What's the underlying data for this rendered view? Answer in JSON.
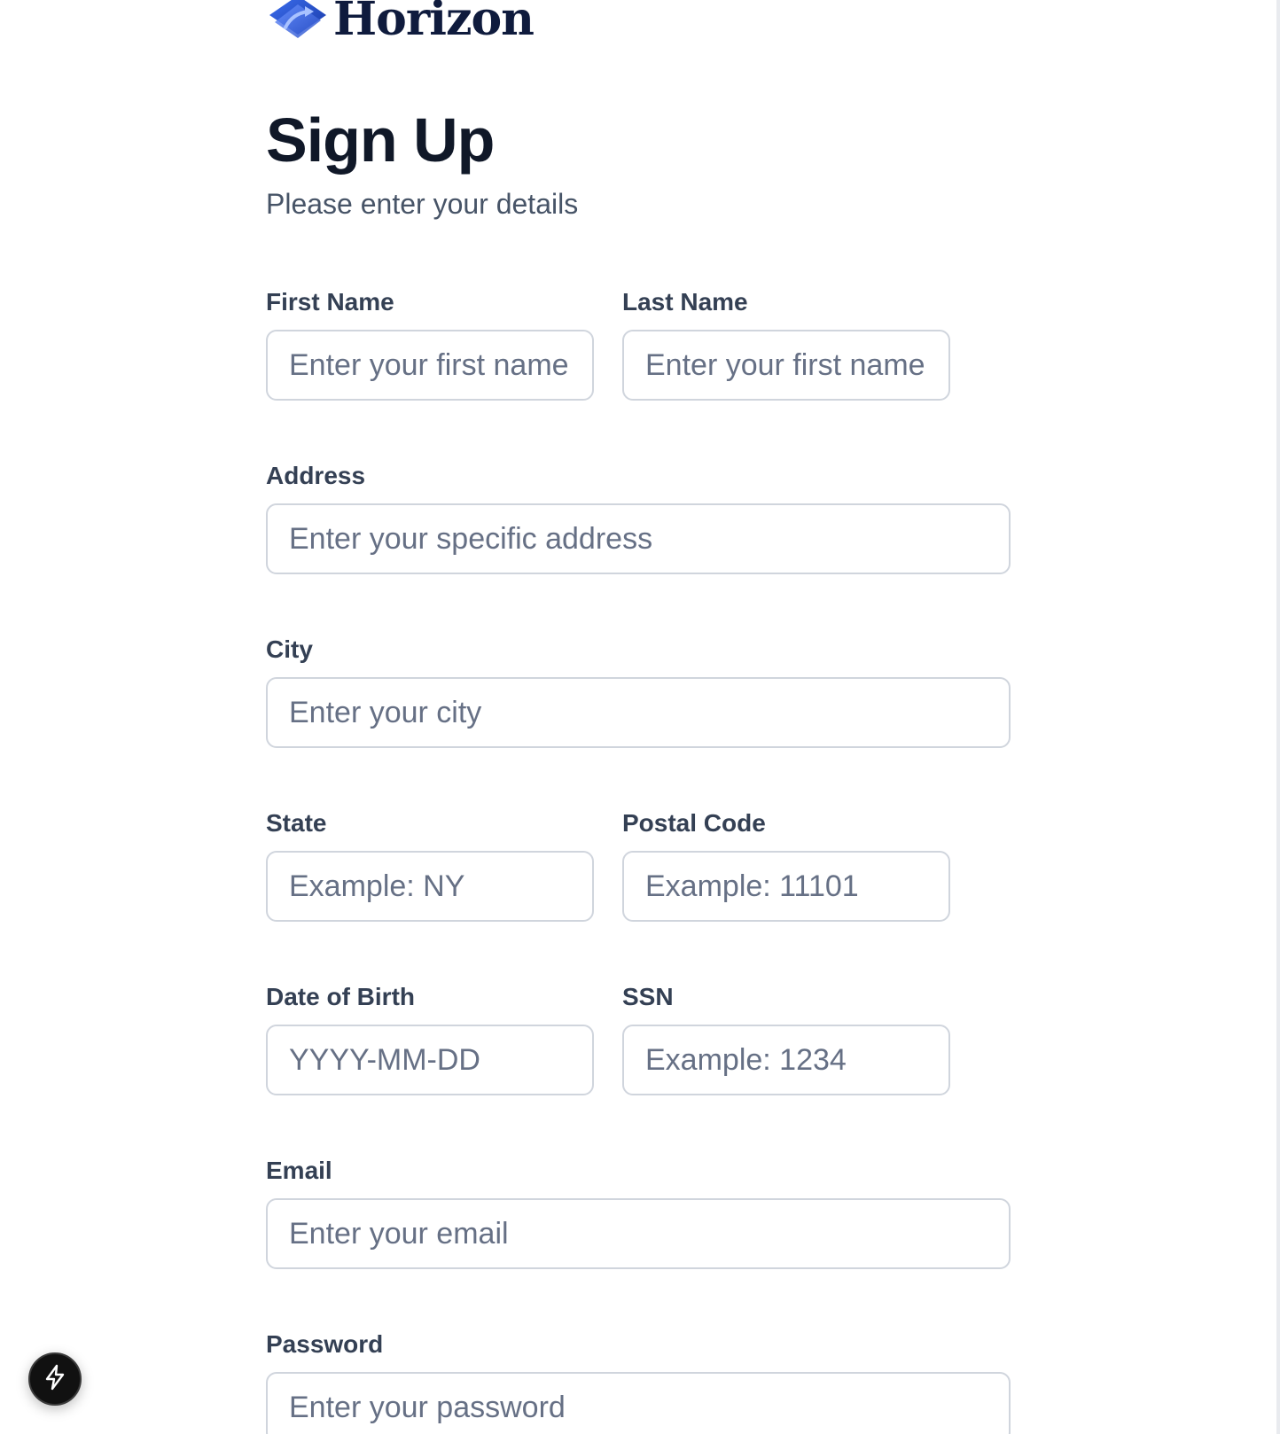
{
  "brand": {
    "name": "Horizon",
    "logo_icon": "horizon-logo-icon",
    "logo_color": "#2d5bd8"
  },
  "header": {
    "title": "Sign Up",
    "subtitle": "Please enter your details"
  },
  "form": {
    "first_name": {
      "label": "First Name",
      "placeholder": "Enter your first name",
      "value": ""
    },
    "last_name": {
      "label": "Last Name",
      "placeholder": "Enter your first name",
      "value": ""
    },
    "address": {
      "label": "Address",
      "placeholder": "Enter your specific address",
      "value": ""
    },
    "city": {
      "label": "City",
      "placeholder": "Enter your city",
      "value": ""
    },
    "state": {
      "label": "State",
      "placeholder": "Example: NY",
      "value": ""
    },
    "postal_code": {
      "label": "Postal Code",
      "placeholder": "Example: 11101",
      "value": ""
    },
    "date_of_birth": {
      "label": "Date of Birth",
      "placeholder": "YYYY-MM-DD",
      "value": ""
    },
    "ssn": {
      "label": "SSN",
      "placeholder": "Example: 1234",
      "value": ""
    },
    "email": {
      "label": "Email",
      "placeholder": "Enter your email",
      "value": ""
    },
    "password": {
      "label": "Password",
      "placeholder": "Enter your password",
      "value": ""
    }
  },
  "floating_button": {
    "icon": "lightning-icon"
  },
  "colors": {
    "text_primary": "#101828",
    "text_secondary": "#475467",
    "label": "#344054",
    "input_border": "#d0d5dd",
    "placeholder": "#667085",
    "brand_dark": "#0f1b3d",
    "accent": "#2d5bd8"
  }
}
